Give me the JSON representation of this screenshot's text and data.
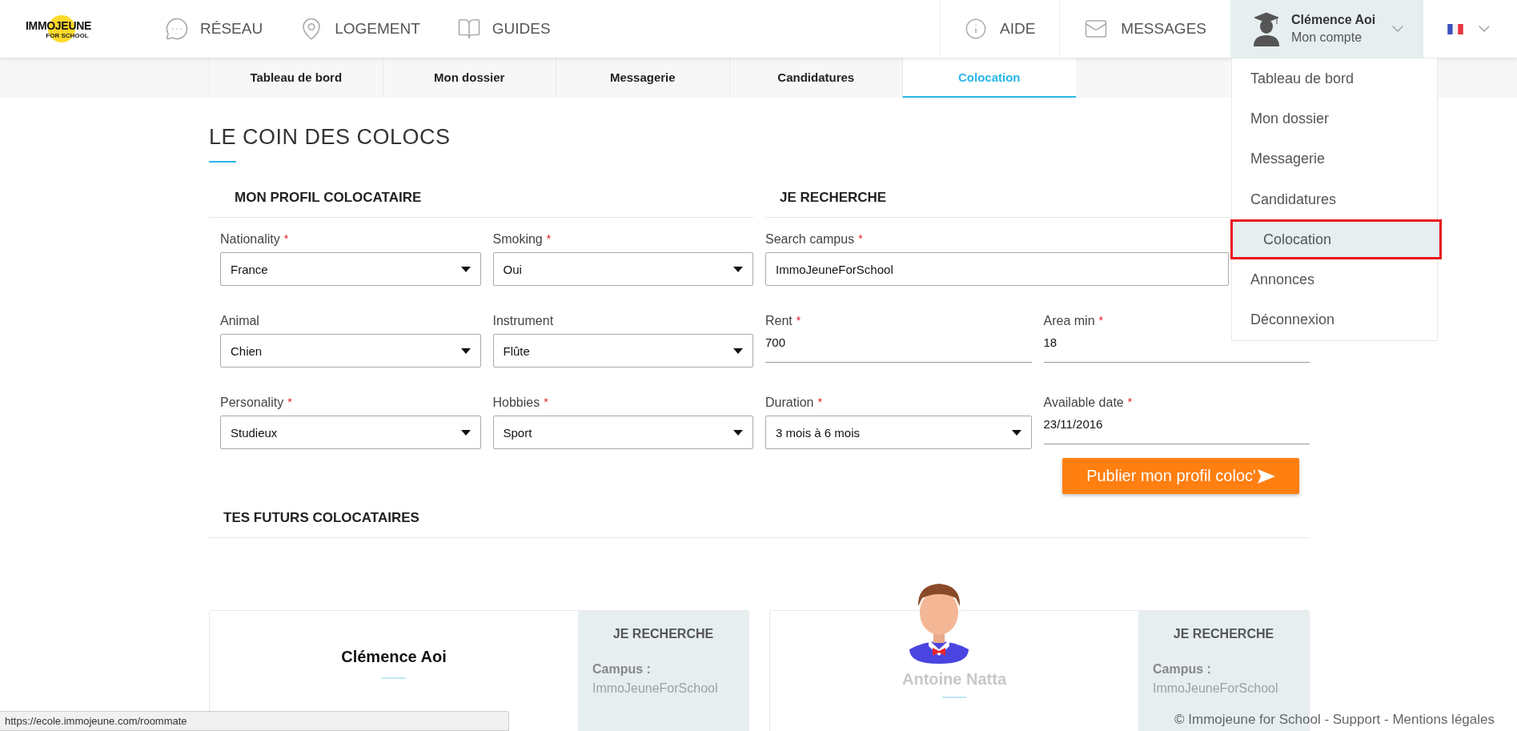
{
  "header": {
    "logo": {
      "text": "IMMOJEUNE",
      "subtext": "FOR SCHOOL"
    },
    "nav": [
      {
        "label": "RÉSEAU"
      },
      {
        "label": "LOGEMENT"
      },
      {
        "label": "GUIDES"
      }
    ],
    "links": [
      {
        "label": "AIDE"
      },
      {
        "label": "MESSAGES"
      }
    ],
    "account": {
      "name": "Clémence Aoi",
      "subtitle": "Mon compte",
      "expanded": true
    }
  },
  "tabs": [
    {
      "label": "Tableau de bord",
      "selected": false
    },
    {
      "label": "Mon dossier",
      "selected": false
    },
    {
      "label": "Messagerie",
      "selected": false
    },
    {
      "label": "Candidatures",
      "selected": false
    },
    {
      "label": "Colocation",
      "selected": true
    }
  ],
  "account_menu": [
    {
      "label": "Tableau de bord",
      "selected": false
    },
    {
      "label": "Mon dossier",
      "selected": false
    },
    {
      "label": "Messagerie",
      "selected": false
    },
    {
      "label": "Candidatures",
      "selected": false
    },
    {
      "label": "Colocation",
      "selected": true
    },
    {
      "label": "Annonces",
      "selected": false
    },
    {
      "label": "Déconnexion",
      "selected": false
    }
  ],
  "page_title": "LE COIN DES COLOCS",
  "profile": {
    "heading": "MON PROFIL COLOCATAIRE",
    "rows": [
      [
        {
          "label": "Nationality",
          "required_mark": "*",
          "kind": "select",
          "value": "France"
        },
        {
          "label": "Smoking",
          "required_mark": "*",
          "kind": "select",
          "value": "Oui"
        }
      ],
      [
        {
          "label": "Animal",
          "kind": "select",
          "value": "Chien"
        },
        {
          "label": "Instrument",
          "kind": "select",
          "value": "Flûte"
        }
      ],
      [
        {
          "label": "Personality",
          "required_mark": "*",
          "kind": "select",
          "value": "Studieux"
        },
        {
          "label": "Hobbies",
          "required_mark": "*",
          "kind": "select",
          "value": "Sport"
        }
      ]
    ]
  },
  "search": {
    "heading": "JE RECHERCHE",
    "rows": [
      [
        {
          "label": "Search campus",
          "required_mark": "*",
          "kind": "input",
          "value": "ImmoJeuneForSchool"
        }
      ],
      [
        {
          "label": "Rent",
          "required_mark": "*",
          "kind": "text",
          "value": "700"
        },
        {
          "label": "Area min",
          "required_mark": "*",
          "kind": "text",
          "value": "18"
        }
      ],
      [
        {
          "label": "Duration",
          "required_mark": "*",
          "kind": "select",
          "value": "3 mois à 6 mois"
        },
        {
          "label": "Available date",
          "required_mark": "*",
          "kind": "text",
          "value": "23/11/2016"
        }
      ]
    ]
  },
  "publish_button": "Publier mon profil coloc'",
  "roommates": {
    "heading": "TES FUTURS COLOCATAIRES",
    "cards": [
      {
        "name": "Clémence Aoi",
        "avatar": false,
        "faded": false,
        "panel_heading": "JE RECHERCHE",
        "campus_label": "Campus :",
        "campus": "ImmoJeuneForSchool"
      },
      {
        "name": "Antoine Natta",
        "avatar": true,
        "faded": true,
        "panel_heading": "JE RECHERCHE",
        "campus_label": "Campus :",
        "campus": "ImmoJeuneForSchool"
      }
    ]
  },
  "status_url": "https://ecole.immojeune.com/roommate",
  "footer": "© Immojeune for School - Support - Mentions légales"
}
